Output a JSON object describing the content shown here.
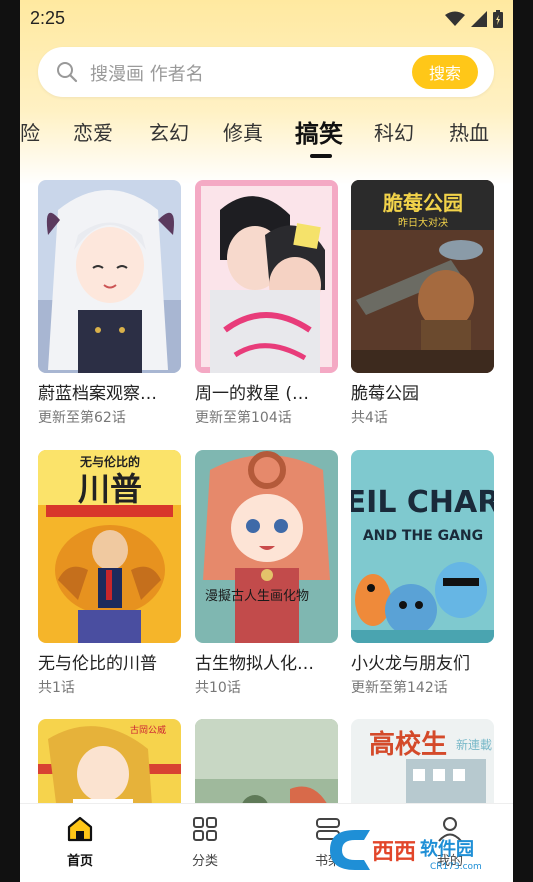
{
  "status": {
    "time": "2:25"
  },
  "search": {
    "placeholder": "搜漫画 作者名",
    "button_label": "搜索"
  },
  "tabs": [
    {
      "label": "险"
    },
    {
      "label": "恋爱"
    },
    {
      "label": "玄幻"
    },
    {
      "label": "修真"
    },
    {
      "label": "搞笑",
      "active": true
    },
    {
      "label": "科幻"
    },
    {
      "label": "热血"
    }
  ],
  "comics": [
    {
      "title": "蔚蓝档案观察…",
      "subtitle": "更新至第62话"
    },
    {
      "title": "周一的救星 (…",
      "subtitle": "更新至第104话"
    },
    {
      "title": "脆莓公园",
      "subtitle": "共4话"
    },
    {
      "title": "无与伦比的川普",
      "subtitle": "共1话"
    },
    {
      "title": "古生物拟人化…",
      "subtitle": "共10话"
    },
    {
      "title": "小火龙与朋友们",
      "subtitle": "更新至第142话"
    },
    {
      "title": "",
      "subtitle": ""
    },
    {
      "title": "",
      "subtitle": ""
    },
    {
      "title": "",
      "subtitle": ""
    }
  ],
  "cover_text": {
    "c3_title": "脆莓公园",
    "c3_sub": "昨日大对决",
    "c4_top": "无与伦比的",
    "c4_main": "川普",
    "c5_text": "漫擬古人生画化物",
    "c6_line1": "EIL CHAR",
    "c6_line2": "AND THE GANG",
    "c7_tag": "古岡公威",
    "c9_title": "高校生",
    "c9_side": "新連載"
  },
  "nav": [
    {
      "label": "首页",
      "icon": "home-icon",
      "active": true
    },
    {
      "label": "分类",
      "icon": "grid-icon"
    },
    {
      "label": "书架",
      "icon": "bookshelf-icon"
    },
    {
      "label": "我的",
      "icon": "user-icon"
    }
  ],
  "watermark": {
    "text1": "西西",
    "text2": "软件园",
    "text3": "CR173.com"
  },
  "colors": {
    "accent": "#ffc718",
    "header_bg": "#ffe9a0"
  }
}
